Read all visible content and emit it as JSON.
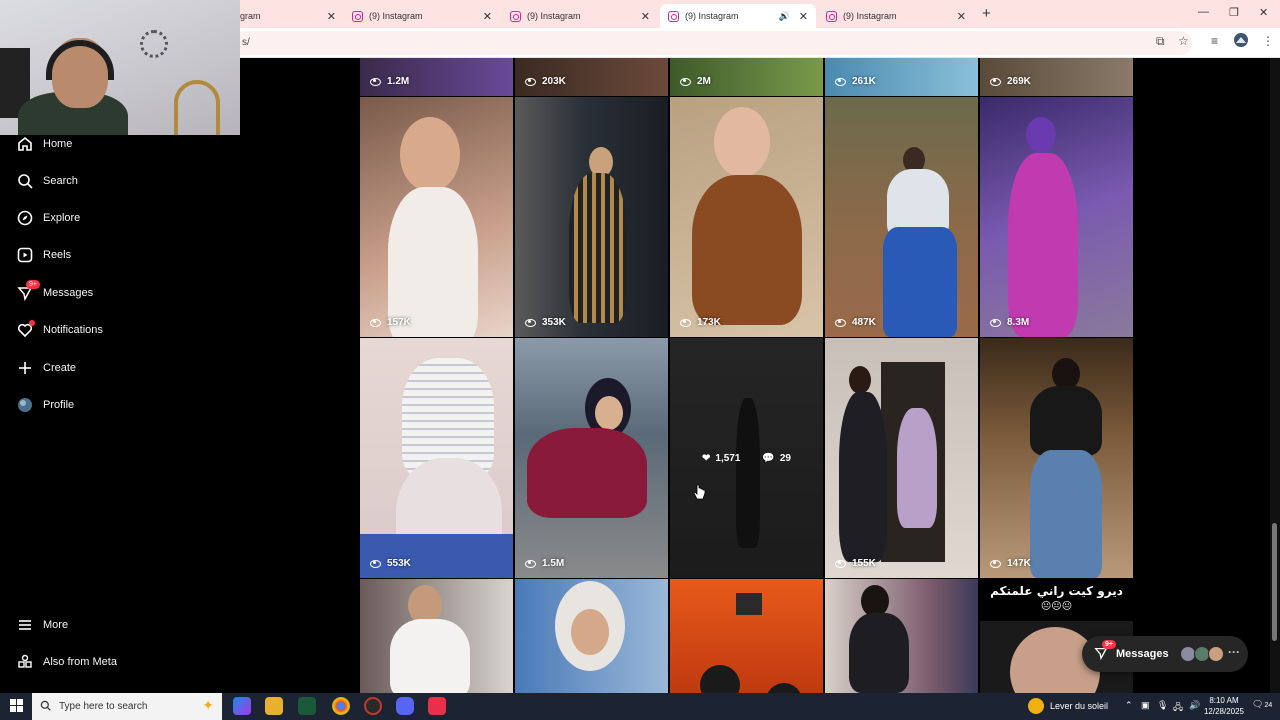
{
  "browser": {
    "tabs": [
      {
        "title": "(9) Instagram",
        "partial_title": "gram",
        "active": false
      },
      {
        "title": "(9) Instagram",
        "active": false
      },
      {
        "title": "(9) Instagram",
        "active": false
      },
      {
        "title": "(9) Instagram",
        "active": true,
        "audio": true
      },
      {
        "title": "(9) Instagram",
        "active": false
      }
    ],
    "new_tab": "+",
    "address_fragment": "s/"
  },
  "sidebar": {
    "items": [
      {
        "label": "Home",
        "icon": "home-icon"
      },
      {
        "label": "Search",
        "icon": "search-icon"
      },
      {
        "label": "Explore",
        "icon": "compass-icon"
      },
      {
        "label": "Reels",
        "icon": "reels-icon"
      },
      {
        "label": "Messages",
        "icon": "messenger-icon",
        "badge": "9+"
      },
      {
        "label": "Notifications",
        "icon": "heart-icon",
        "dot": true
      },
      {
        "label": "Create",
        "icon": "plus-icon"
      },
      {
        "label": "Profile",
        "icon": "avatar-icon"
      }
    ],
    "bottom": [
      {
        "label": "More",
        "icon": "menu-icon"
      },
      {
        "label": "Also from Meta",
        "icon": "meta-icon"
      }
    ]
  },
  "grid": {
    "rows": [
      {
        "views": [
          "1.2M",
          "203K",
          "2M",
          "261K",
          "269K"
        ]
      },
      {
        "views": [
          "157K",
          "353K",
          "173K",
          "487K",
          "8.3M"
        ]
      },
      {
        "views": [
          "553K",
          "1.5M",
          "",
          "155K",
          "147K"
        ]
      }
    ],
    "hover": {
      "likes": "1,571",
      "comments": "29"
    },
    "caption_arabic": "ديرو كيت راني علمتكم",
    "caption_emoji": "😐😐😐"
  },
  "messages_pill": {
    "label": "Messages",
    "badge": "9+"
  },
  "taskbar": {
    "search_placeholder": "Type here to search",
    "weather": "Lever du soleil",
    "time": "8:10 AM",
    "date": "12/28/2025",
    "notification_count": "24"
  }
}
